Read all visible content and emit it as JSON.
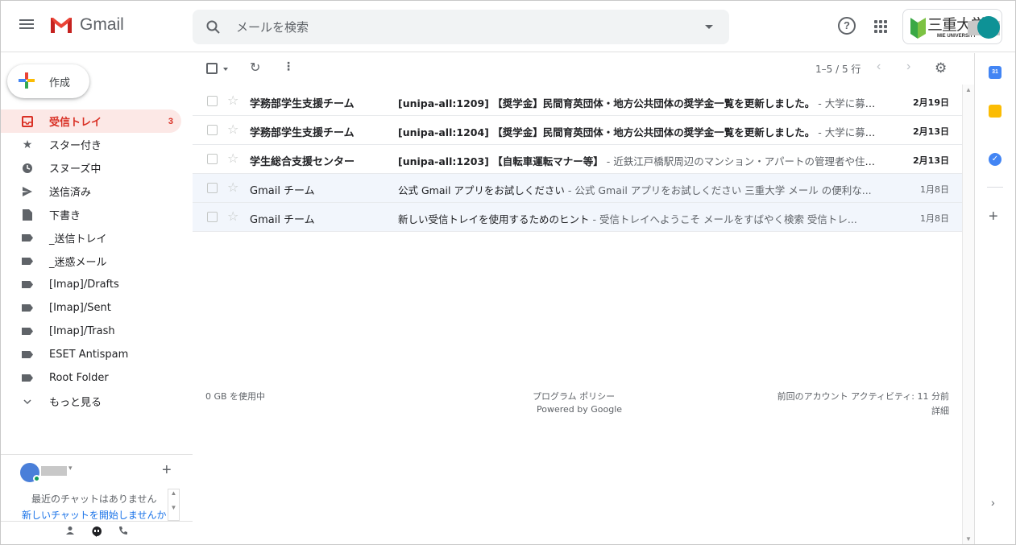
{
  "header": {
    "app_name": "Gmail",
    "search_placeholder": "メールを検索",
    "university_name": "三重大学",
    "university_sub": "MIE UNIVERSITY"
  },
  "compose_label": "作成",
  "sidebar": {
    "items": [
      {
        "label": "受信トレイ",
        "count": "3",
        "icon": "inbox-icon"
      },
      {
        "label": "スター付き",
        "icon": "star-icon"
      },
      {
        "label": "スヌーズ中",
        "icon": "clock-icon"
      },
      {
        "label": "送信済み",
        "icon": "send-icon"
      },
      {
        "label": "下書き",
        "icon": "draft-icon"
      },
      {
        "label": "_送信トレイ",
        "icon": "label-icon"
      },
      {
        "label": "_迷惑メール",
        "icon": "label-icon"
      },
      {
        "label": "[Imap]/Drafts",
        "icon": "label-icon"
      },
      {
        "label": "[Imap]/Sent",
        "icon": "label-icon"
      },
      {
        "label": "[Imap]/Trash",
        "icon": "label-icon"
      },
      {
        "label": "ESET Antispam",
        "icon": "label-icon"
      },
      {
        "label": "Root Folder",
        "icon": "label-icon"
      },
      {
        "label": "もっと見る",
        "icon": "chevron-down-icon"
      }
    ]
  },
  "hangouts": {
    "no_chats": "最近のチャットはありません",
    "start_chat": "新しいチャットを開始しませんか"
  },
  "toolbar": {
    "range": "1–5 / 5 行"
  },
  "emails": [
    {
      "from": "学務部学生支援チーム",
      "subject": "[unipa-all:1209] 【奨学金】民間育英団体・地方公共団体の奨学金一覧を更新しました。",
      "snippet": " - 大学に募集...",
      "date": "2月19日",
      "unread": true
    },
    {
      "from": "学務部学生支援チーム",
      "subject": "[unipa-all:1204] 【奨学金】民間育英団体・地方公共団体の奨学金一覧を更新しました。",
      "snippet": " - 大学に募集...",
      "date": "2月13日",
      "unread": true
    },
    {
      "from": "学生総合支援センター",
      "subject": "[unipa-all:1203] 【自転車運転マナー等】",
      "snippet": " - 近鉄江戸橋駅周辺のマンション・アパートの管理者や住民...",
      "date": "2月13日",
      "unread": true
    },
    {
      "from": "Gmail チーム",
      "subject": "公式 Gmail アプリをお試しください",
      "snippet": " - 公式 Gmail アプリをお試しください 三重大学 メール の便利な...",
      "date": "1月8日",
      "unread": false
    },
    {
      "from": "Gmail チーム",
      "subject": "新しい受信トレイを使用するためのヒント",
      "snippet": " - 受信トレイへようこそ メールをすばやく検索 受信トレ...",
      "date": "1月8日",
      "unread": false
    }
  ],
  "footer": {
    "usage": "0 GB を使用中",
    "policy": "プログラム ポリシー",
    "powered": "Powered by Google",
    "activity": "前回のアカウント アクティビティ: 11 分前",
    "details": "詳細"
  },
  "right_panel": {
    "calendar_day": "31"
  }
}
